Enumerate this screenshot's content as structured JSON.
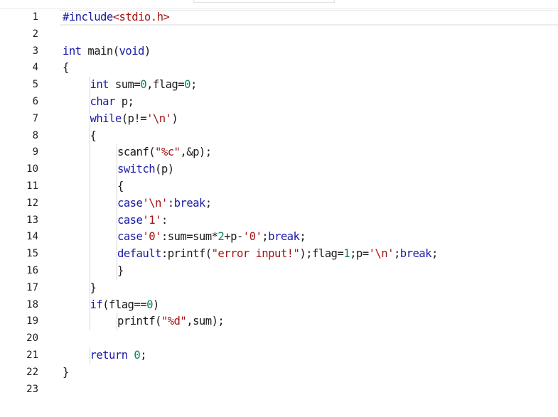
{
  "window": {
    "title": ""
  },
  "colors": {
    "plain": "#1a1a1a",
    "keyword": "#1a1aa6",
    "number": "#098658",
    "string": "#a31515",
    "line_number": "#222222",
    "indent_guide": "#d4d4d4",
    "current_line_border": "#ececec"
  },
  "editor": {
    "language": "c",
    "lines": [
      {
        "number": "1",
        "indent": 0,
        "tokens": [
          {
            "t": "preproc",
            "v": "#include"
          },
          {
            "t": "string",
            "v": "<stdio.h>"
          }
        ]
      },
      {
        "number": "2",
        "indent": 0,
        "tokens": []
      },
      {
        "number": "3",
        "indent": 0,
        "tokens": [
          {
            "t": "keyword",
            "v": "int"
          },
          {
            "t": "plain",
            "v": " main("
          },
          {
            "t": "keyword",
            "v": "void"
          },
          {
            "t": "plain",
            "v": ")"
          }
        ]
      },
      {
        "number": "4",
        "indent": 0,
        "tokens": [
          {
            "t": "plain",
            "v": "{"
          }
        ]
      },
      {
        "number": "5",
        "indent": 1,
        "tokens": [
          {
            "t": "keyword",
            "v": "int"
          },
          {
            "t": "plain",
            "v": " sum="
          },
          {
            "t": "number",
            "v": "0"
          },
          {
            "t": "plain",
            "v": ",flag="
          },
          {
            "t": "number",
            "v": "0"
          },
          {
            "t": "plain",
            "v": ";"
          }
        ]
      },
      {
        "number": "6",
        "indent": 1,
        "tokens": [
          {
            "t": "keyword",
            "v": "char"
          },
          {
            "t": "plain",
            "v": " p;"
          }
        ]
      },
      {
        "number": "7",
        "indent": 1,
        "tokens": [
          {
            "t": "keyword",
            "v": "while"
          },
          {
            "t": "plain",
            "v": "(p!="
          },
          {
            "t": "string",
            "v": "'\\n'"
          },
          {
            "t": "plain",
            "v": ")"
          }
        ]
      },
      {
        "number": "8",
        "indent": 1,
        "tokens": [
          {
            "t": "plain",
            "v": "{"
          }
        ]
      },
      {
        "number": "9",
        "indent": 2,
        "tokens": [
          {
            "t": "plain",
            "v": "scanf("
          },
          {
            "t": "string",
            "v": "\"%c\""
          },
          {
            "t": "plain",
            "v": ",&p);"
          }
        ]
      },
      {
        "number": "10",
        "indent": 2,
        "tokens": [
          {
            "t": "keyword",
            "v": "switch"
          },
          {
            "t": "plain",
            "v": "(p)"
          }
        ]
      },
      {
        "number": "11",
        "indent": 2,
        "tokens": [
          {
            "t": "plain",
            "v": "{"
          }
        ]
      },
      {
        "number": "12",
        "indent": 2,
        "tokens": [
          {
            "t": "keyword",
            "v": "case"
          },
          {
            "t": "string",
            "v": "'\\n'"
          },
          {
            "t": "plain",
            "v": ":"
          },
          {
            "t": "keyword",
            "v": "break"
          },
          {
            "t": "plain",
            "v": ";"
          }
        ]
      },
      {
        "number": "13",
        "indent": 2,
        "tokens": [
          {
            "t": "keyword",
            "v": "case"
          },
          {
            "t": "string",
            "v": "'1'"
          },
          {
            "t": "plain",
            "v": ":"
          }
        ]
      },
      {
        "number": "14",
        "indent": 2,
        "tokens": [
          {
            "t": "keyword",
            "v": "case"
          },
          {
            "t": "string",
            "v": "'0'"
          },
          {
            "t": "plain",
            "v": ":sum=sum*"
          },
          {
            "t": "number",
            "v": "2"
          },
          {
            "t": "plain",
            "v": "+p-"
          },
          {
            "t": "string",
            "v": "'0'"
          },
          {
            "t": "plain",
            "v": ";"
          },
          {
            "t": "keyword",
            "v": "break"
          },
          {
            "t": "plain",
            "v": ";"
          }
        ]
      },
      {
        "number": "15",
        "indent": 2,
        "tokens": [
          {
            "t": "keyword",
            "v": "default"
          },
          {
            "t": "plain",
            "v": ":printf("
          },
          {
            "t": "string",
            "v": "\"error input!\""
          },
          {
            "t": "plain",
            "v": ");flag="
          },
          {
            "t": "number",
            "v": "1"
          },
          {
            "t": "plain",
            "v": ";p="
          },
          {
            "t": "string",
            "v": "'\\n'"
          },
          {
            "t": "plain",
            "v": ";"
          },
          {
            "t": "keyword",
            "v": "break"
          },
          {
            "t": "plain",
            "v": ";"
          }
        ]
      },
      {
        "number": "16",
        "indent": 2,
        "tokens": [
          {
            "t": "plain",
            "v": "}"
          }
        ]
      },
      {
        "number": "17",
        "indent": 1,
        "tokens": [
          {
            "t": "plain",
            "v": "}"
          }
        ]
      },
      {
        "number": "18",
        "indent": 1,
        "tokens": [
          {
            "t": "keyword",
            "v": "if"
          },
          {
            "t": "plain",
            "v": "(flag=="
          },
          {
            "t": "number",
            "v": "0"
          },
          {
            "t": "plain",
            "v": ")"
          }
        ]
      },
      {
        "number": "19",
        "indent": 2,
        "tokens": [
          {
            "t": "plain",
            "v": "printf("
          },
          {
            "t": "string",
            "v": "\"%d\""
          },
          {
            "t": "plain",
            "v": ",sum);"
          }
        ]
      },
      {
        "number": "20",
        "indent": 0,
        "tokens": []
      },
      {
        "number": "21",
        "indent": 1,
        "tokens": [
          {
            "t": "keyword",
            "v": "return"
          },
          {
            "t": "plain",
            "v": " "
          },
          {
            "t": "number",
            "v": "0"
          },
          {
            "t": "plain",
            "v": ";"
          }
        ]
      },
      {
        "number": "22",
        "indent": 0,
        "tokens": [
          {
            "t": "plain",
            "v": "}"
          }
        ]
      },
      {
        "number": "23",
        "indent": 0,
        "tokens": []
      }
    ]
  }
}
